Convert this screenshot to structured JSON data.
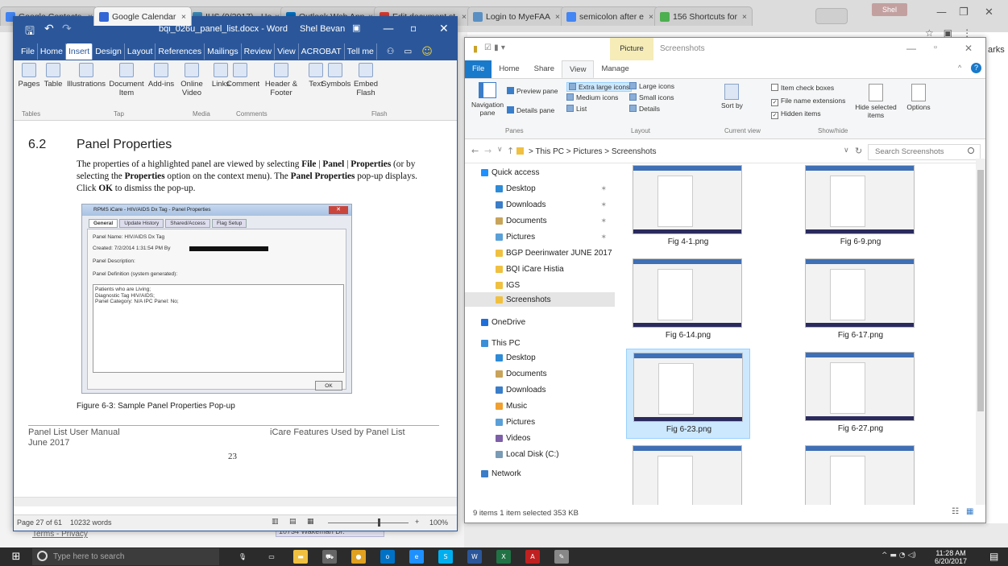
{
  "chrome": {
    "tabs": [
      {
        "label": "Google Contacts",
        "color": "#4285f4",
        "active": false
      },
      {
        "label": "Google Calendar",
        "color": "#3367d6",
        "active": true
      },
      {
        "label": "IHS (9/2017) - Ho",
        "color": "#3c8dbc",
        "active": false
      },
      {
        "label": "Outlook Web App",
        "color": "#0072c6",
        "active": false
      },
      {
        "label": "Edit document st",
        "color": "#e03c31",
        "active": false
      },
      {
        "label": "Login to MyeFAA",
        "color": "#5a8fc3",
        "active": false
      },
      {
        "label": "semicolon after e",
        "color": "#4285f4",
        "active": false
      },
      {
        "label": "156 Shortcuts for",
        "color": "#4caf50",
        "active": false
      }
    ],
    "user_label": "Shel",
    "bookmark_frag": "arks"
  },
  "background": {
    "terms_link": "Terms - Privacy",
    "address_fragment": "10734 Wakeman Dr."
  },
  "word": {
    "doc_title": "bqi_026u_panel_list.docx - Word",
    "user": "Shel Bevan",
    "menu": [
      "File",
      "Home",
      "Insert",
      "Design",
      "Layout",
      "References",
      "Mailings",
      "Review",
      "View",
      "ACROBAT",
      "Tell me"
    ],
    "active_menu": "Insert",
    "ribbon_buttons": [
      "Pages",
      "Table",
      "Illustrations",
      "Document Item",
      "Add-ins",
      "Online Video",
      "Links",
      "Comment",
      "Header & Footer",
      "Text",
      "Symbols",
      "Embed Flash"
    ],
    "ribbon_groups": [
      "Tables",
      "Tap",
      "Media",
      "Comments",
      "Flash"
    ],
    "section_number": "6.2",
    "section_title": "Panel Properties",
    "body_parts": [
      "The properties of a highlighted panel are viewed by selecting ",
      "File",
      " | ",
      "Panel",
      " | ",
      "Properties",
      " (or by selecting the ",
      "Properties",
      " option on the context menu). The ",
      "Panel Properties",
      " pop-up displays. Click ",
      "OK",
      " to dismiss the pop-up."
    ],
    "figure": {
      "title": "RPMS iCare - HIV/AIDS Dx Tag - Panel Properties",
      "tabs": [
        "General",
        "Update History",
        "Shared/Access",
        "Flag Setup"
      ],
      "panel_name": "Panel Name: HIV/AIDS Dx Tag",
      "created": "Created:  7/2/2014 1:31:54 PM By",
      "description_label": "Panel Description:",
      "definition_label": "Panel Definition (system generated):",
      "definition_lines": [
        "Patients who are Living;",
        "Diagnostic Tag HIV/AIDS;",
        "Panel Category: N/A   IPC Panel: No;"
      ],
      "ok": "OK"
    },
    "caption": "Figure 6-3: Sample Panel Properties Pop-up",
    "footer_left_1": "Panel List User Manual",
    "footer_left_2": "June 2017",
    "footer_right": "iCare Features Used by Panel List",
    "page_number": "23",
    "status_page": "Page 27 of 61",
    "status_words": "10232 words",
    "zoom": "100%"
  },
  "explorer": {
    "picture_tools": "Picture Tools",
    "title": "Screenshots",
    "menu": [
      "File",
      "Home",
      "Share",
      "View",
      "Manage"
    ],
    "active_menu": "View",
    "ribbon": {
      "nav_pane": "Navigation pane",
      "preview_pane": "Preview pane",
      "details_pane": "Details pane",
      "layout": [
        "Extra large icons",
        "Large icons",
        "Medium icons",
        "Small icons",
        "List",
        "Details"
      ],
      "sort_by": "Sort by",
      "checks": [
        "Item check boxes",
        "File name extensions",
        "Hidden items"
      ],
      "hide_selected": "Hide selected items",
      "options": "Options",
      "groups": [
        "Panes",
        "Layout",
        "Current view",
        "Show/hide"
      ]
    },
    "address": "> This PC > Pictures > Screenshots",
    "search_placeholder": "Search Screenshots",
    "nav": [
      {
        "label": "Quick access",
        "color": "#1e90ff",
        "pinned": false
      },
      {
        "label": "Desktop",
        "color": "#2e8bd6",
        "pinned": true
      },
      {
        "label": "Downloads",
        "color": "#3a7dc9",
        "pinned": true
      },
      {
        "label": "Documents",
        "color": "#c8a35a",
        "pinned": true
      },
      {
        "label": "Pictures",
        "color": "#5aa0d8",
        "pinned": true
      },
      {
        "label": "BGP Deerinwater JUNE 2017",
        "color": "#f0c040",
        "pinned": false
      },
      {
        "label": "BQI iCare Histia",
        "color": "#f0c040",
        "pinned": false
      },
      {
        "label": "IGS",
        "color": "#f0c040",
        "pinned": false
      },
      {
        "label": "Screenshots",
        "color": "#f0c040",
        "pinned": false,
        "selected": true
      },
      {
        "label": "OneDrive",
        "color": "#1e6fd9",
        "pinned": false
      },
      {
        "label": "This PC",
        "color": "#3a8fd6",
        "pinned": false
      },
      {
        "label": "Desktop",
        "color": "#2e8bd6",
        "pinned": false
      },
      {
        "label": "Documents",
        "color": "#c8a35a",
        "pinned": false
      },
      {
        "label": "Downloads",
        "color": "#3a7dc9",
        "pinned": false
      },
      {
        "label": "Music",
        "color": "#f0a030",
        "pinned": false
      },
      {
        "label": "Pictures",
        "color": "#5aa0d8",
        "pinned": false
      },
      {
        "label": "Videos",
        "color": "#7d5fa8",
        "pinned": false
      },
      {
        "label": "Local Disk (C:)",
        "color": "#7a9bb5",
        "pinned": false
      },
      {
        "label": "Network",
        "color": "#3a7dc9",
        "pinned": false
      }
    ],
    "files": [
      "Fig 4-1.png",
      "Fig 6-9.png",
      "Fig 6-14.png",
      "Fig 6-17.png",
      "Fig 6-23.png",
      "Fig 6-27.png",
      "",
      ""
    ],
    "selected_file": "Fig 6-23.png",
    "status": "9 items    1 item selected  353 KB"
  },
  "taskbar": {
    "search_placeholder": "Type here to search",
    "time": "11:28 AM",
    "date": "6/20/2017",
    "apps": [
      {
        "icon": "mic-icon",
        "color": "#2b2b2b"
      },
      {
        "icon": "task-view-icon",
        "color": "#2b2b2b"
      },
      {
        "icon": "file-explorer-icon",
        "color": "#f0c040"
      },
      {
        "icon": "store-icon",
        "color": "#666666"
      },
      {
        "icon": "chrome-icon",
        "color": "#e0a020"
      },
      {
        "icon": "outlook-icon",
        "color": "#0072c6"
      },
      {
        "icon": "edge-icon",
        "color": "#1e90ff"
      },
      {
        "icon": "skype-icon",
        "color": "#00aff0"
      },
      {
        "icon": "word-icon",
        "color": "#2b579a"
      },
      {
        "icon": "excel-icon",
        "color": "#217346"
      },
      {
        "icon": "acrobat-icon",
        "color": "#c02020"
      },
      {
        "icon": "paint-icon",
        "color": "#888888"
      }
    ]
  }
}
